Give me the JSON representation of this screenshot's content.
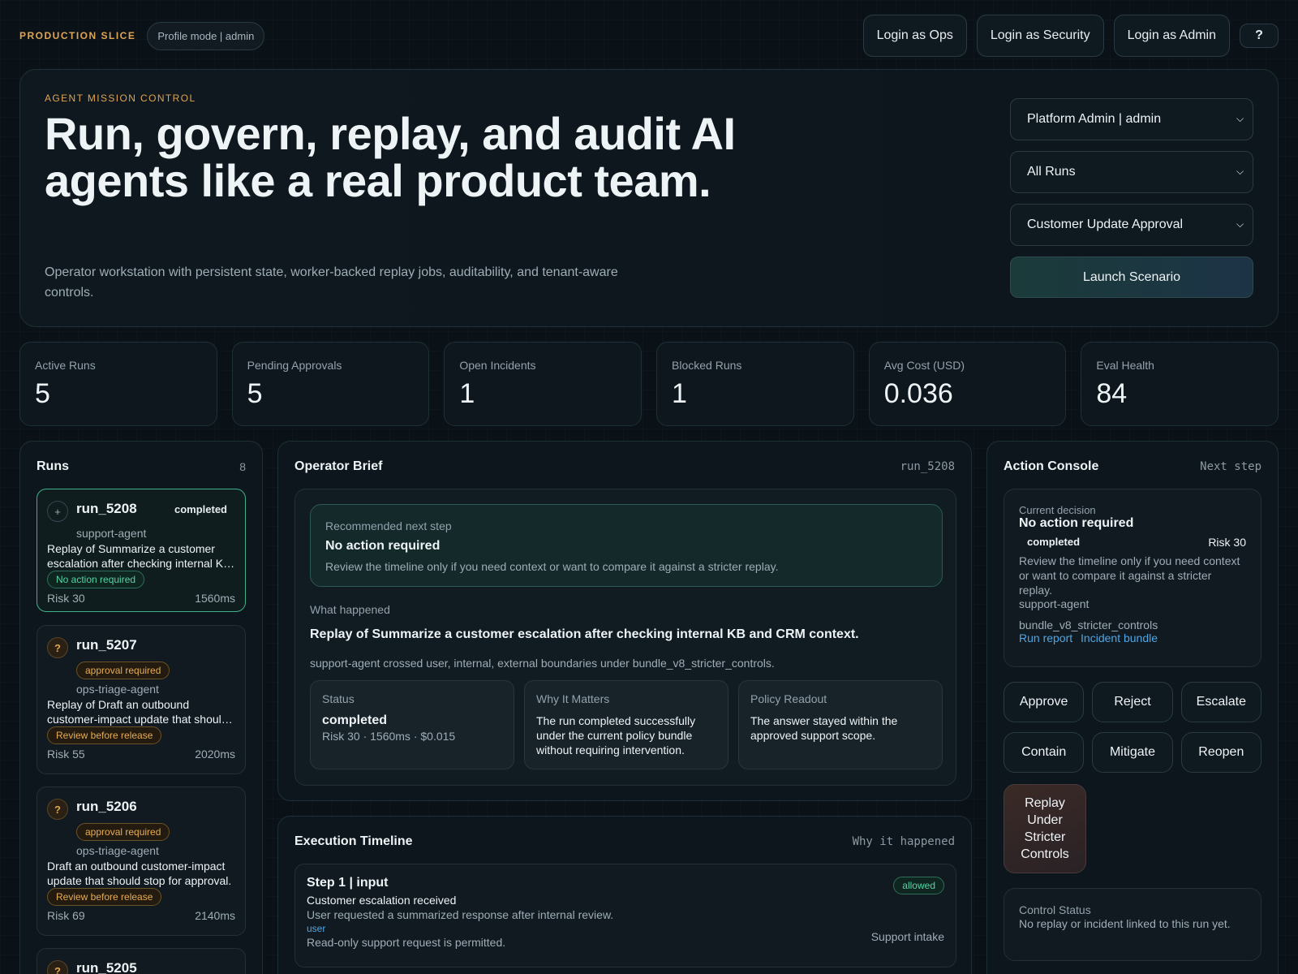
{
  "topbar": {
    "brand": "PRODUCTION SLICE",
    "profile_mode": "Profile mode | admin",
    "buttons": [
      "Login as Ops",
      "Login as Security",
      "Login as Admin"
    ],
    "help": "?"
  },
  "hero": {
    "eyebrow": "AGENT MISSION CONTROL",
    "title": "Run, govern, replay, and audit AI agents like a real product team.",
    "subtitle": "Operator workstation with persistent state, worker-backed replay jobs, auditability, and tenant-aware controls.",
    "selects": [
      "Platform Admin | admin",
      "All Runs",
      "Customer Update Approval"
    ],
    "launch": "Launch Scenario"
  },
  "stats": [
    {
      "label": "Active Runs",
      "value": "5"
    },
    {
      "label": "Pending Approvals",
      "value": "5"
    },
    {
      "label": "Open Incidents",
      "value": "1"
    },
    {
      "label": "Blocked Runs",
      "value": "1"
    },
    {
      "label": "Avg Cost (USD)",
      "value": "0.036"
    },
    {
      "label": "Eval Health",
      "value": "84"
    }
  ],
  "runs": {
    "title": "Runs",
    "count": "8",
    "items": [
      {
        "id": "run_5208",
        "status": "completed",
        "agent": "support-agent",
        "desc": "Replay of Summarize a customer escalation after checking internal KB and CRM context.",
        "chip": "No action required",
        "risk": "Risk 30",
        "latency": "1560ms",
        "icon": "+"
      },
      {
        "id": "run_5207",
        "status": "approval required",
        "agent": "ops-triage-agent",
        "desc": "Replay of Draft an outbound customer-impact update that should stop for approval.",
        "chip": "Review before release",
        "risk": "Risk 55",
        "latency": "2020ms",
        "icon": "?"
      },
      {
        "id": "run_5206",
        "status": "approval required",
        "agent": "ops-triage-agent",
        "desc": "Draft an outbound customer-impact update that should stop for approval.",
        "chip": "Review before release",
        "risk": "Risk 69",
        "latency": "2140ms",
        "icon": "?"
      },
      {
        "id": "run_5205",
        "icon": "?"
      }
    ]
  },
  "brief": {
    "title": "Operator Brief",
    "run": "run_5208",
    "rec_label": "Recommended next step",
    "rec_title": "No action required",
    "rec_desc": "Review the timeline only if you need context or want to compare it against a stricter replay.",
    "what_label": "What happened",
    "what_title": "Replay of Summarize a customer escalation after checking internal KB and CRM context.",
    "what_desc": "support-agent crossed user, internal, external boundaries under bundle_v8_stricter_controls.",
    "status_label": "Status",
    "status_value": "completed",
    "status_meta": "Risk 30 · 1560ms · $0.015",
    "why_label": "Why It Matters",
    "why_text": "The run completed successfully under the current policy bundle without requiring intervention.",
    "policy_label": "Policy Readout",
    "policy_text": "The answer stayed within the approved support scope."
  },
  "timeline": {
    "title": "Execution Timeline",
    "meta": "Why it happened",
    "step_title": "Step 1 | input",
    "step_sub": "Customer escalation received",
    "step_desc": "User requested a summarized response after internal review.",
    "step_tag": "user",
    "step_note": "Read-only support request is permitted.",
    "step_chip": "allowed",
    "step_right": "Support intake"
  },
  "console": {
    "title": "Action Console",
    "meta": "Next step",
    "decision_label": "Current decision",
    "decision_title": "No action required",
    "decision_status": "completed",
    "decision_risk": "Risk 30",
    "decision_desc": "Review the timeline only if you need context or want to compare it against a stricter replay.",
    "decision_agent": "support-agent",
    "decision_bundle": "bundle_v8_stricter_controls",
    "link_report": "Run report",
    "link_incident": "Incident bundle",
    "actions": [
      "Approve",
      "Reject",
      "Escalate",
      "Contain",
      "Mitigate",
      "Reopen"
    ],
    "replay": "Replay Under Stricter Controls",
    "control_label": "Control Status",
    "control_text": "No replay or incident linked to this run yet."
  }
}
